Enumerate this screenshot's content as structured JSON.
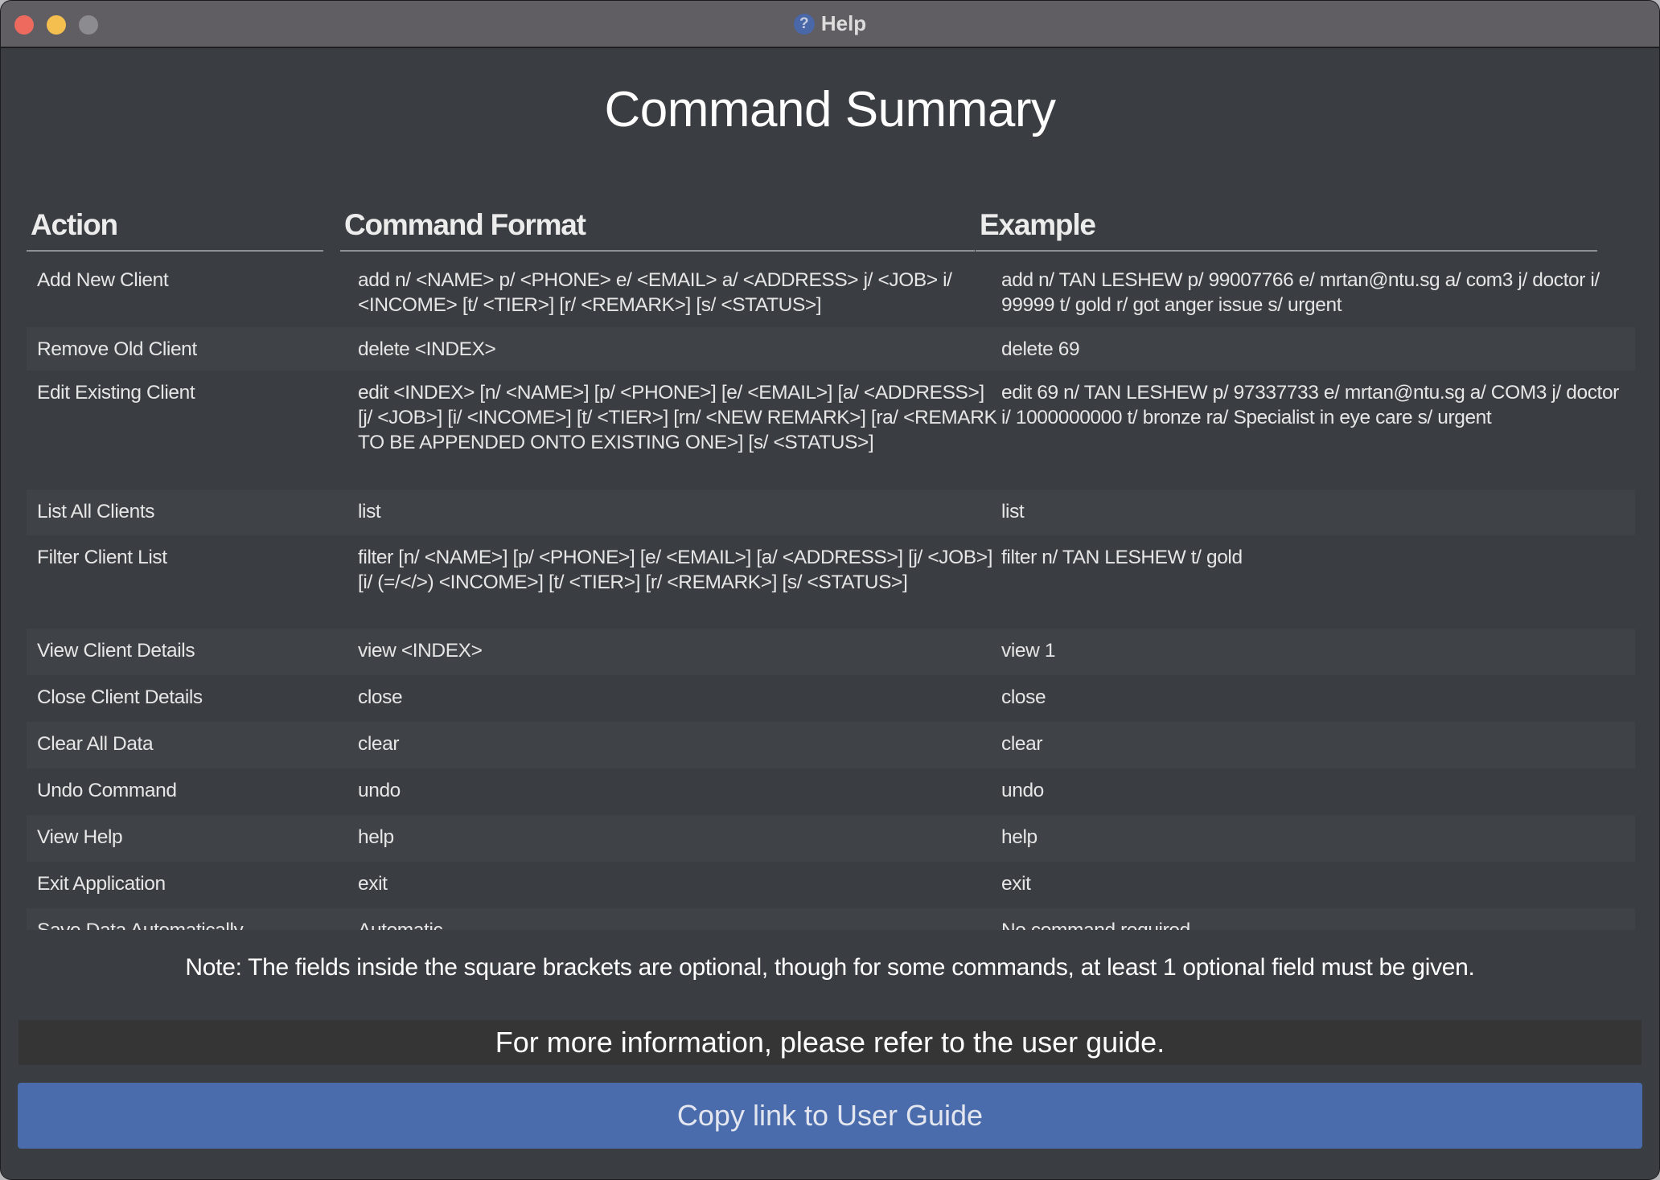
{
  "window": {
    "title": "Help",
    "title_icon": "help-question-icon"
  },
  "heading": "Command Summary",
  "table": {
    "headers": [
      "Action",
      "Command Format",
      "Example"
    ],
    "rows": [
      {
        "action": "Add New Client",
        "format": "add n/ <NAME> p/ <PHONE> e/ <EMAIL> a/ <ADDRESS> j/ <JOB> i/ <INCOME> [t/ <TIER>] [r/ <REMARK>] [s/ <STATUS>]",
        "example": "add n/ TAN LESHEW p/ 99007766 e/ mrtan@ntu.sg a/ com3 j/ doctor i/ 99999 t/ gold r/ got anger issue s/ urgent"
      },
      {
        "action": "Remove Old Client",
        "format": "delete <INDEX>",
        "example": "delete 69"
      },
      {
        "action": "Edit Existing Client",
        "format": "edit <INDEX> [n/ <NAME>] [p/ <PHONE>] [e/ <EMAIL>] [a/ <ADDRESS>] [j/ <JOB>] [i/ <INCOME>] [t/ <TIER>] [rn/ <NEW REMARK>] [ra/ <REMARK TO BE APPENDED ONTO EXISTING ONE>] [s/ <STATUS>]",
        "example": "edit 69 n/ TAN LESHEW p/ 97337733 e/ mrtan@ntu.sg a/ COM3 j/ doctor i/ 1000000000 t/ bronze ra/ Specialist in eye care s/ urgent"
      },
      {
        "action": "List All Clients",
        "format": "list",
        "example": "list"
      },
      {
        "action": "Filter Client List",
        "format": "filter [n/ <NAME>] [p/ <PHONE>] [e/ <EMAIL>] [a/ <ADDRESS>] [j/ <JOB>] [i/ (=/</>) <INCOME>] [t/ <TIER>] [r/ <REMARK>] [s/ <STATUS>]",
        "example": "filter n/ TAN LESHEW t/ gold"
      },
      {
        "action": "View Client Details",
        "format": "view <INDEX>",
        "example": "view 1"
      },
      {
        "action": "Close Client Details",
        "format": "close",
        "example": "close"
      },
      {
        "action": "Clear All Data",
        "format": "clear",
        "example": "clear"
      },
      {
        "action": "Undo Command",
        "format": "undo",
        "example": "undo"
      },
      {
        "action": "View Help",
        "format": "help",
        "example": "help"
      },
      {
        "action": "Exit Application",
        "format": "exit",
        "example": "exit"
      },
      {
        "action": "Save Data Automatically",
        "format": "Automatic",
        "example": "No command required"
      }
    ]
  },
  "note": "Note: The fields inside the square brackets are optional, though for some commands, at least 1 optional field must be given.",
  "more_info": "For more information, please refer to the user guide.",
  "copy_button": "Copy link to User Guide",
  "colors": {
    "background": "#3a3d41",
    "row_alt": "#3f4246",
    "button": "#4a6cad",
    "titlebar": "#605e63"
  }
}
